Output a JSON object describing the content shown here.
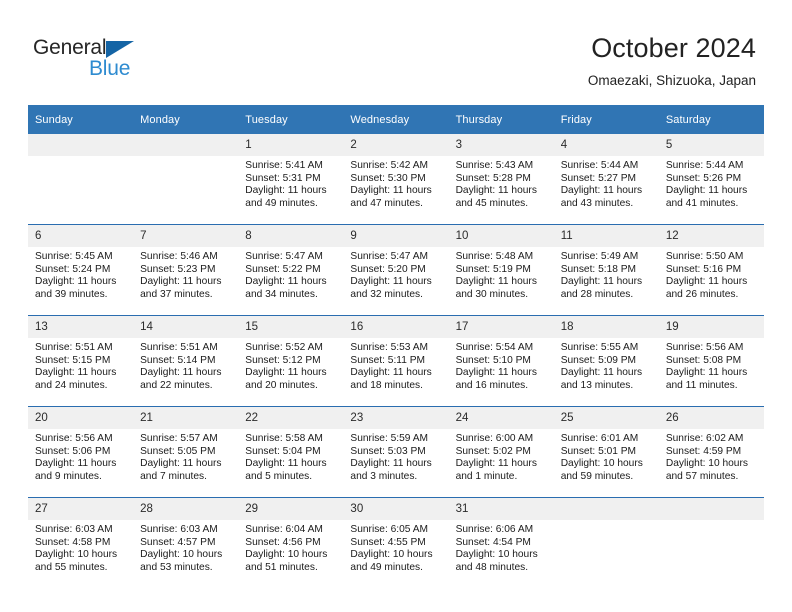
{
  "brand": {
    "name_part1": "General",
    "name_part2": "Blue",
    "accent_color": "#2e8bd0",
    "triangle_color": "#1464a5"
  },
  "header": {
    "title": "October 2024",
    "subtitle": "Omaezaki, Shizuoka, Japan"
  },
  "calendar": {
    "header_bg": "#3075b4",
    "row_border_color": "#2a6db0",
    "daynum_bg": "#f0f0f0",
    "weekday_headers": [
      "Sunday",
      "Monday",
      "Tuesday",
      "Wednesday",
      "Thursday",
      "Friday",
      "Saturday"
    ],
    "weeks": [
      [
        {
          "day": "",
          "sunrise": "",
          "sunset": "",
          "daylight": ""
        },
        {
          "day": "",
          "sunrise": "",
          "sunset": "",
          "daylight": ""
        },
        {
          "day": "1",
          "sunrise": "Sunrise: 5:41 AM",
          "sunset": "Sunset: 5:31 PM",
          "daylight": "Daylight: 11 hours and 49 minutes."
        },
        {
          "day": "2",
          "sunrise": "Sunrise: 5:42 AM",
          "sunset": "Sunset: 5:30 PM",
          "daylight": "Daylight: 11 hours and 47 minutes."
        },
        {
          "day": "3",
          "sunrise": "Sunrise: 5:43 AM",
          "sunset": "Sunset: 5:28 PM",
          "daylight": "Daylight: 11 hours and 45 minutes."
        },
        {
          "day": "4",
          "sunrise": "Sunrise: 5:44 AM",
          "sunset": "Sunset: 5:27 PM",
          "daylight": "Daylight: 11 hours and 43 minutes."
        },
        {
          "day": "5",
          "sunrise": "Sunrise: 5:44 AM",
          "sunset": "Sunset: 5:26 PM",
          "daylight": "Daylight: 11 hours and 41 minutes."
        }
      ],
      [
        {
          "day": "6",
          "sunrise": "Sunrise: 5:45 AM",
          "sunset": "Sunset: 5:24 PM",
          "daylight": "Daylight: 11 hours and 39 minutes."
        },
        {
          "day": "7",
          "sunrise": "Sunrise: 5:46 AM",
          "sunset": "Sunset: 5:23 PM",
          "daylight": "Daylight: 11 hours and 37 minutes."
        },
        {
          "day": "8",
          "sunrise": "Sunrise: 5:47 AM",
          "sunset": "Sunset: 5:22 PM",
          "daylight": "Daylight: 11 hours and 34 minutes."
        },
        {
          "day": "9",
          "sunrise": "Sunrise: 5:47 AM",
          "sunset": "Sunset: 5:20 PM",
          "daylight": "Daylight: 11 hours and 32 minutes."
        },
        {
          "day": "10",
          "sunrise": "Sunrise: 5:48 AM",
          "sunset": "Sunset: 5:19 PM",
          "daylight": "Daylight: 11 hours and 30 minutes."
        },
        {
          "day": "11",
          "sunrise": "Sunrise: 5:49 AM",
          "sunset": "Sunset: 5:18 PM",
          "daylight": "Daylight: 11 hours and 28 minutes."
        },
        {
          "day": "12",
          "sunrise": "Sunrise: 5:50 AM",
          "sunset": "Sunset: 5:16 PM",
          "daylight": "Daylight: 11 hours and 26 minutes."
        }
      ],
      [
        {
          "day": "13",
          "sunrise": "Sunrise: 5:51 AM",
          "sunset": "Sunset: 5:15 PM",
          "daylight": "Daylight: 11 hours and 24 minutes."
        },
        {
          "day": "14",
          "sunrise": "Sunrise: 5:51 AM",
          "sunset": "Sunset: 5:14 PM",
          "daylight": "Daylight: 11 hours and 22 minutes."
        },
        {
          "day": "15",
          "sunrise": "Sunrise: 5:52 AM",
          "sunset": "Sunset: 5:12 PM",
          "daylight": "Daylight: 11 hours and 20 minutes."
        },
        {
          "day": "16",
          "sunrise": "Sunrise: 5:53 AM",
          "sunset": "Sunset: 5:11 PM",
          "daylight": "Daylight: 11 hours and 18 minutes."
        },
        {
          "day": "17",
          "sunrise": "Sunrise: 5:54 AM",
          "sunset": "Sunset: 5:10 PM",
          "daylight": "Daylight: 11 hours and 16 minutes."
        },
        {
          "day": "18",
          "sunrise": "Sunrise: 5:55 AM",
          "sunset": "Sunset: 5:09 PM",
          "daylight": "Daylight: 11 hours and 13 minutes."
        },
        {
          "day": "19",
          "sunrise": "Sunrise: 5:56 AM",
          "sunset": "Sunset: 5:08 PM",
          "daylight": "Daylight: 11 hours and 11 minutes."
        }
      ],
      [
        {
          "day": "20",
          "sunrise": "Sunrise: 5:56 AM",
          "sunset": "Sunset: 5:06 PM",
          "daylight": "Daylight: 11 hours and 9 minutes."
        },
        {
          "day": "21",
          "sunrise": "Sunrise: 5:57 AM",
          "sunset": "Sunset: 5:05 PM",
          "daylight": "Daylight: 11 hours and 7 minutes."
        },
        {
          "day": "22",
          "sunrise": "Sunrise: 5:58 AM",
          "sunset": "Sunset: 5:04 PM",
          "daylight": "Daylight: 11 hours and 5 minutes."
        },
        {
          "day": "23",
          "sunrise": "Sunrise: 5:59 AM",
          "sunset": "Sunset: 5:03 PM",
          "daylight": "Daylight: 11 hours and 3 minutes."
        },
        {
          "day": "24",
          "sunrise": "Sunrise: 6:00 AM",
          "sunset": "Sunset: 5:02 PM",
          "daylight": "Daylight: 11 hours and 1 minute."
        },
        {
          "day": "25",
          "sunrise": "Sunrise: 6:01 AM",
          "sunset": "Sunset: 5:01 PM",
          "daylight": "Daylight: 10 hours and 59 minutes."
        },
        {
          "day": "26",
          "sunrise": "Sunrise: 6:02 AM",
          "sunset": "Sunset: 4:59 PM",
          "daylight": "Daylight: 10 hours and 57 minutes."
        }
      ],
      [
        {
          "day": "27",
          "sunrise": "Sunrise: 6:03 AM",
          "sunset": "Sunset: 4:58 PM",
          "daylight": "Daylight: 10 hours and 55 minutes."
        },
        {
          "day": "28",
          "sunrise": "Sunrise: 6:03 AM",
          "sunset": "Sunset: 4:57 PM",
          "daylight": "Daylight: 10 hours and 53 minutes."
        },
        {
          "day": "29",
          "sunrise": "Sunrise: 6:04 AM",
          "sunset": "Sunset: 4:56 PM",
          "daylight": "Daylight: 10 hours and 51 minutes."
        },
        {
          "day": "30",
          "sunrise": "Sunrise: 6:05 AM",
          "sunset": "Sunset: 4:55 PM",
          "daylight": "Daylight: 10 hours and 49 minutes."
        },
        {
          "day": "31",
          "sunrise": "Sunrise: 6:06 AM",
          "sunset": "Sunset: 4:54 PM",
          "daylight": "Daylight: 10 hours and 48 minutes."
        },
        {
          "day": "",
          "sunrise": "",
          "sunset": "",
          "daylight": ""
        },
        {
          "day": "",
          "sunrise": "",
          "sunset": "",
          "daylight": ""
        }
      ]
    ]
  }
}
